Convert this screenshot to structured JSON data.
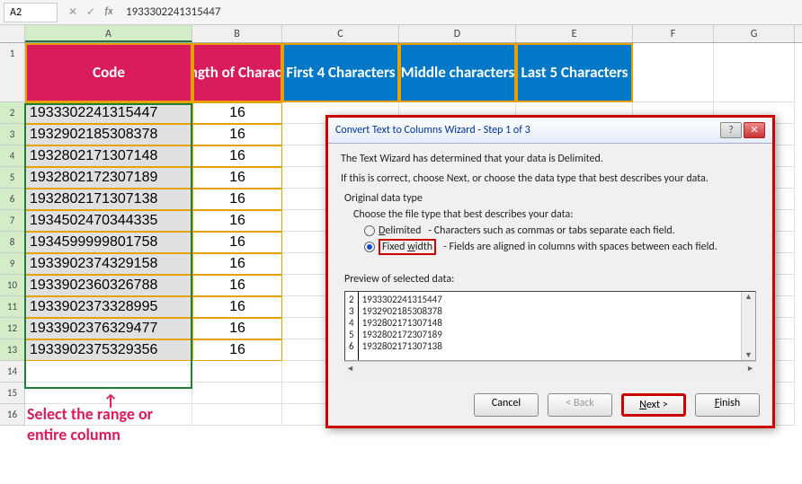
{
  "formula_bar": {
    "name_box": "A2",
    "value": "1933302241315447"
  },
  "columns": [
    "A",
    "B",
    "C",
    "D",
    "E",
    "F",
    "G"
  ],
  "headers": {
    "A": "Code",
    "B": "Length of Character",
    "C": "First 4 Characters",
    "D": "Middle characters",
    "E": "Last 5 Characters"
  },
  "rows": [
    {
      "code": "1933302241315447",
      "len": "16"
    },
    {
      "code": "1932902185308378",
      "len": "16"
    },
    {
      "code": "1932802171307148",
      "len": "16"
    },
    {
      "code": "1932802172307189",
      "len": "16"
    },
    {
      "code": "1932802171307138",
      "len": "16"
    },
    {
      "code": "1934502470344335",
      "len": "16"
    },
    {
      "code": "1934599999801758",
      "len": "16"
    },
    {
      "code": "1933902374329158",
      "len": "16"
    },
    {
      "code": "1933902360326788",
      "len": "16"
    },
    {
      "code": "1933902373328995",
      "len": "16"
    },
    {
      "code": "1933902376329477",
      "len": "16"
    },
    {
      "code": "1933902375329356",
      "len": "16"
    }
  ],
  "annotation": {
    "line1": "Select the range or",
    "line2": "entire column"
  },
  "dialog": {
    "title": "Convert Text to Columns Wizard - Step 1 of 3",
    "intro1": "The Text Wizard has determined that your data is Delimited.",
    "intro2": "If this is correct, choose Next, or choose the data type that best describes your data.",
    "section": "Original data type",
    "choose": "Choose the file type that best describes your data:",
    "opt_delimited": "Delimited",
    "opt_delimited_desc": "- Characters such as commas or tabs separate each field.",
    "opt_fixed": "Fixed width",
    "opt_fixed_desc": "- Fields are aligned in columns with spaces between each field.",
    "preview_label": "Preview of selected data:",
    "preview": [
      {
        "n": "2",
        "v": "1933302241315447"
      },
      {
        "n": "3",
        "v": "1932902185308378"
      },
      {
        "n": "4",
        "v": "1932802171307148"
      },
      {
        "n": "5",
        "v": "1932802172307189"
      },
      {
        "n": "6",
        "v": "1932802171307138"
      }
    ],
    "buttons": {
      "cancel": "Cancel",
      "back": "< Back",
      "next": "Next >",
      "finish": "Finish"
    }
  }
}
